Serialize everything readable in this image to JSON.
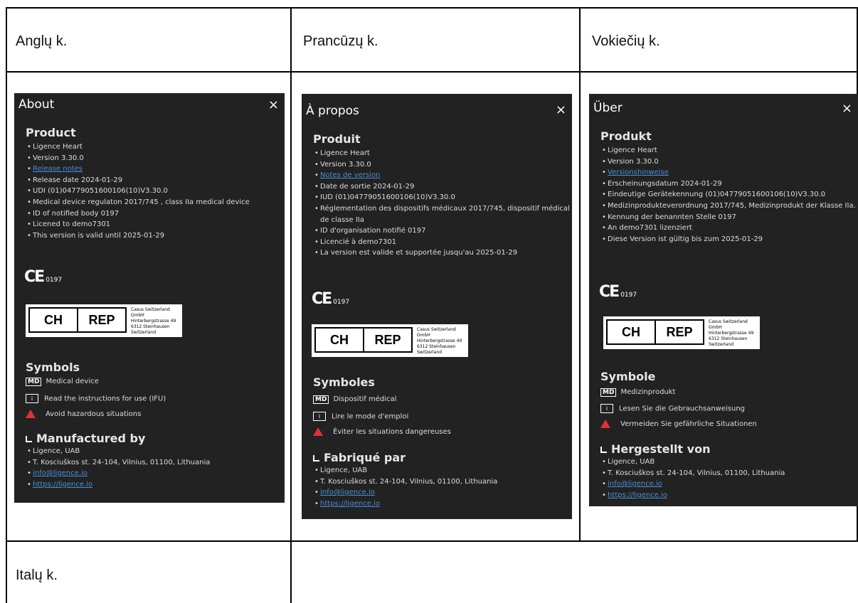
{
  "headers": {
    "english": "Anglų k.",
    "french": "Prancūzų k.",
    "german": "Vokiečių k.",
    "italian": "Italų k."
  },
  "close_icon": "×",
  "panels": {
    "en": {
      "title": "About",
      "product_heading": "Product",
      "product": [
        "Ligence Heart",
        "Version 3.30.0",
        "Release notes",
        "Release date 2024-01-29",
        "UDI (01)04779051600106(10)V3.30.0",
        "Medical device regulaton 2017/745 , class IIa medical device",
        "ID of notified body 0197",
        "Licened to demo7301",
        "This version is valid until 2025-01-29"
      ],
      "ce": "CE",
      "ce_num": "0197",
      "rep": {
        "ch": "CH",
        "rep": "REP",
        "l1": "Casus Switzerland GmbH",
        "l2": "Hinterbergstrasse 49",
        "l3": "6312 Steinhausen",
        "l4": "Switzerland"
      },
      "symbols_heading": "Symbols",
      "md_badge": "MD",
      "sym_md": "Medical device",
      "sym_ifu": "Read the instructions for use (IFU)",
      "sym_warn": "Avoid hazardous situations",
      "mfr_heading": "Manufactured by",
      "mfr": [
        "Ligence, UAB",
        "T. Kosciuškos st. 24-104, Vilnius, 01100, Lithuania",
        "info@ligence.io",
        "https://ligence.io"
      ]
    },
    "fr": {
      "title": "À propos",
      "product_heading": "Produit",
      "product": [
        "Ligence Heart",
        "Version 3.30.0",
        "Notes de version",
        "Date de sortie 2024-01-29",
        "IUD (01)04779051600106(10)V3.30.0",
        "Réglementation des dispositifs médicaux 2017/745, dispositif médical de classe IIa",
        "ID d'organisation notifié 0197",
        "Licencié à demo7301",
        "La version est valide et supportée jusqu'au 2025-01-29"
      ],
      "ce": "CE",
      "ce_num": "0197",
      "rep": {
        "ch": "CH",
        "rep": "REP",
        "l1": "Casus Switzerland GmbH",
        "l2": "Hinterbergstrasse 49",
        "l3": "6312 Steinhausen",
        "l4": "Switzerland"
      },
      "symbols_heading": "Symboles",
      "md_badge": "MD",
      "sym_md": "Dispositif médical",
      "sym_ifu": "Lire le mode d'emploi",
      "sym_warn": "Éviter les situations dangereuses",
      "mfr_heading": "Fabriqué par",
      "mfr": [
        "Ligence, UAB",
        "T. Kosciuškos st. 24-104, Vilnius, 01100, Lithuania",
        "info@ligence.io",
        "https://ligence.io"
      ]
    },
    "de": {
      "title": "Über",
      "product_heading": "Produkt",
      "product": [
        "Ligence Heart",
        "Version 3.30.0",
        "Versionshinweise",
        "Erscheinungsdatum 2024-01-29",
        "Eindeutige Gerätekennung (01)04779051600106(10)V3.30.0",
        "Medizinprodukteverordnung 2017/745, Medizinprodukt der Klasse IIa.",
        "Kennung der benannten Stelle 0197",
        "An demo7301 lizenziert",
        "Diese Version ist gültig bis zum 2025-01-29"
      ],
      "ce": "CE",
      "ce_num": "0197",
      "rep": {
        "ch": "CH",
        "rep": "REP",
        "l1": "Casus Switzerland GmbH",
        "l2": "Hinterbergstrasse 49",
        "l3": "6312 Steinhausen",
        "l4": "Switzerland"
      },
      "symbols_heading": "Symbole",
      "md_badge": "MD",
      "sym_md": "Medizinprodukt",
      "sym_ifu": "Lesen Sie die Gebrauchsanweisung",
      "sym_warn": "Vermeiden Sie gefährliche Situationen",
      "mfr_heading": "Hergestellt von",
      "mfr": [
        "Ligence, UAB",
        "T. Kosciuškos st. 24-104, Vilnius, 01100, Lithuania",
        "info@ligence.io",
        "https://ligence.io"
      ]
    }
  }
}
